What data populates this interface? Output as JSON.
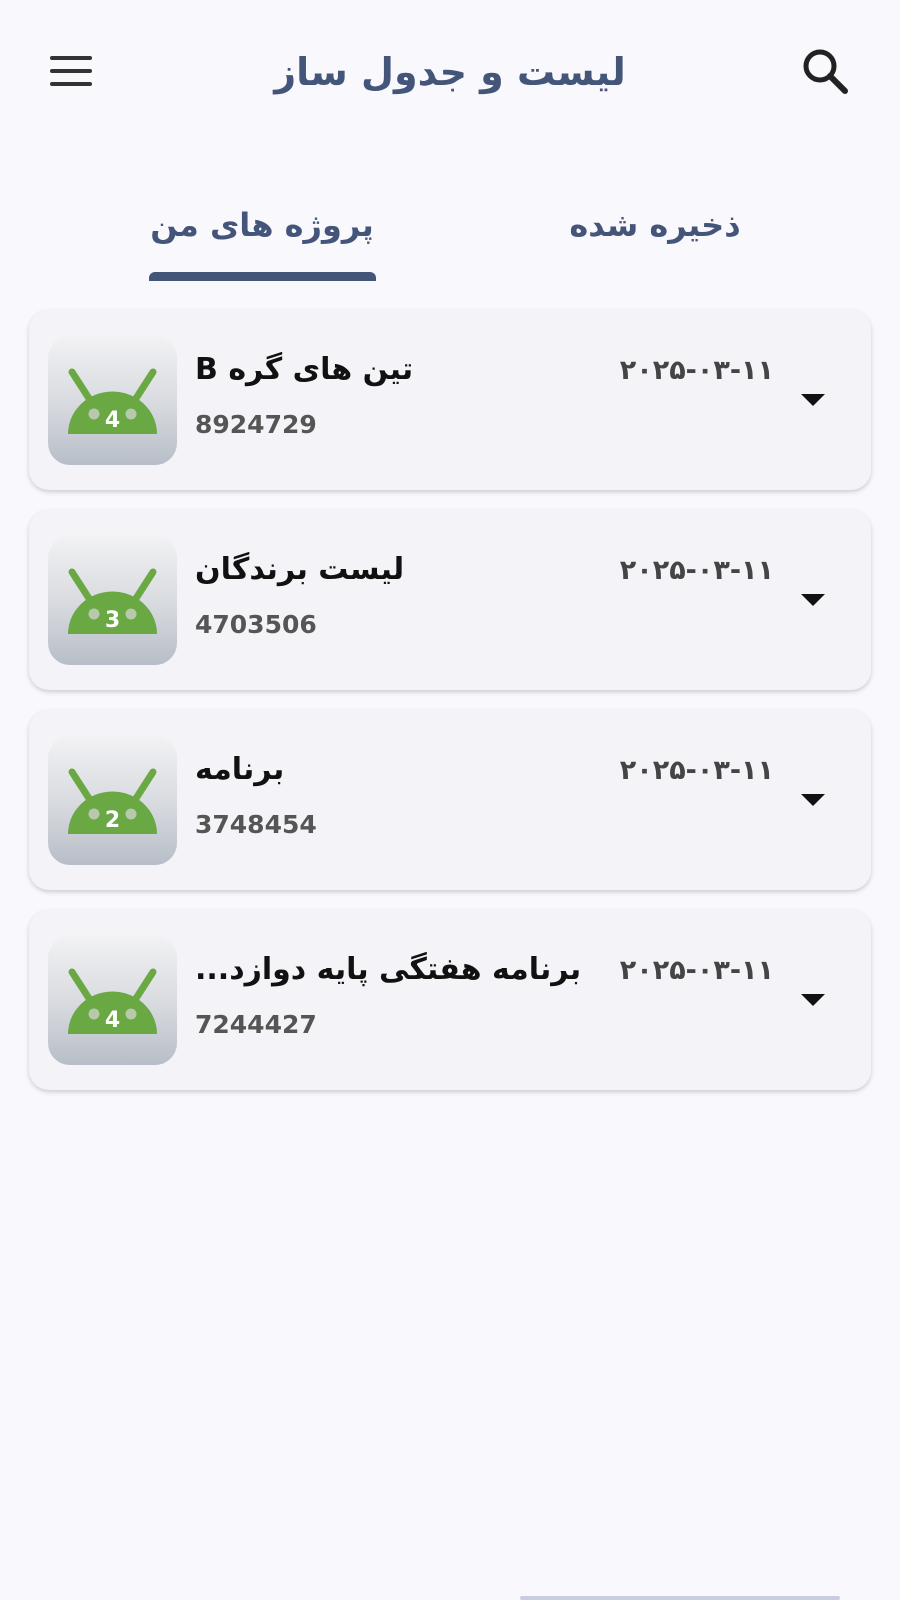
{
  "app": {
    "title": "لیست و جدول ساز"
  },
  "tabs": [
    {
      "label": "ذخیره شده",
      "active": false
    },
    {
      "label": "پروژه های من",
      "active": true
    }
  ],
  "projects": [
    {
      "title": "تین های گره B",
      "id": "8924729",
      "date": "۲۰۲۵-۰۳-۱۱",
      "badge": "4"
    },
    {
      "title": "لیست برندگان",
      "id": "4703506",
      "date": "۲۰۲۵-۰۳-۱۱",
      "badge": "3"
    },
    {
      "title": "برنامه",
      "id": "3748454",
      "date": "۲۰۲۵-۰۳-۱۱",
      "badge": "2"
    },
    {
      "title": "برنامه هفتگی پایه دوازد...",
      "id": "7244427",
      "date": "۲۰۲۵-۰۳-۱۱",
      "badge": "4"
    }
  ],
  "colors": {
    "primary": "#44557a",
    "background": "#f9f8fd",
    "card": "#f4f3f8",
    "android_green": "#6aa844"
  },
  "icons": {
    "menu": "hamburger-menu-icon",
    "search": "search-icon",
    "expand": "chevron-down-icon",
    "project": "android-robot-icon"
  }
}
